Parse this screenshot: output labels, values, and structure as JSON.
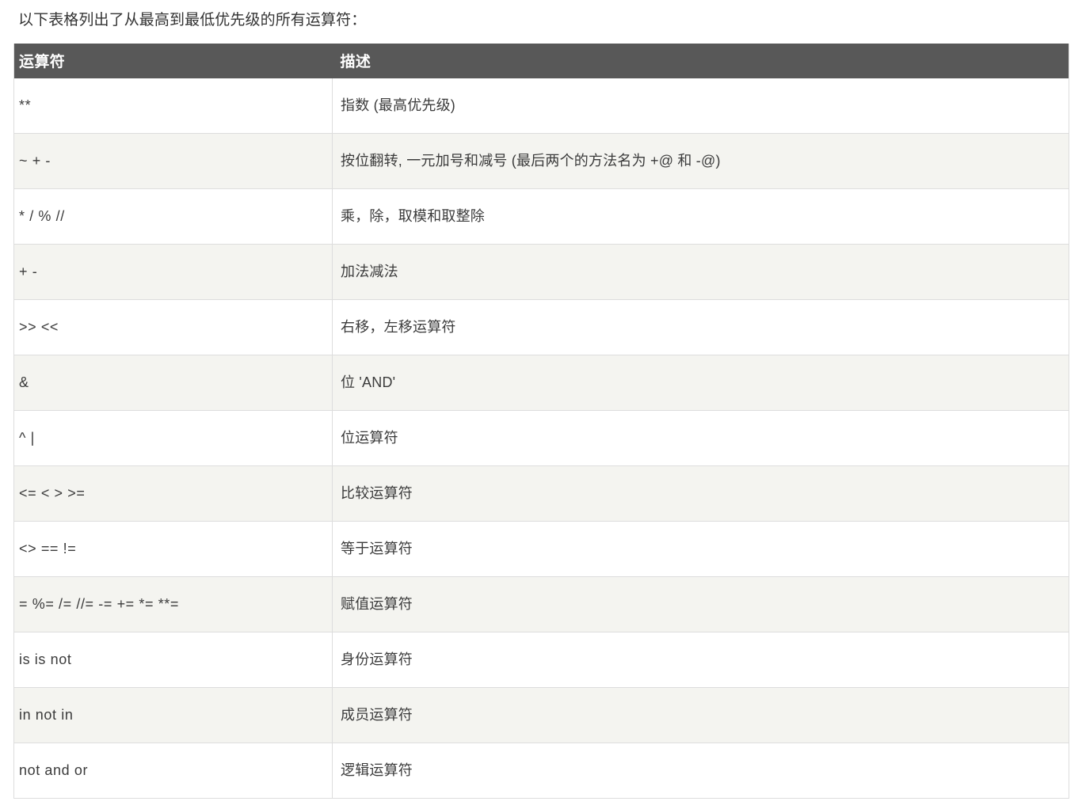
{
  "intro": "以下表格列出了从最高到最低优先级的所有运算符：",
  "table": {
    "columns": [
      {
        "key": "operator",
        "label": "运算符"
      },
      {
        "key": "description",
        "label": "描述"
      }
    ],
    "header_background": "#585858",
    "header_text_color": "#ffffff",
    "zebra_color": "#f4f4f0",
    "border_color": "#dddddd",
    "rows": [
      {
        "operator": "**",
        "description": "指数 (最高优先级)"
      },
      {
        "operator": "~ + -",
        "description": "按位翻转, 一元加号和减号 (最后两个的方法名为 +@ 和 -@)"
      },
      {
        "operator": "* / % //",
        "description": "乘，除，取模和取整除"
      },
      {
        "operator": "+ -",
        "description": "加法减法"
      },
      {
        "operator": ">> <<",
        "description": "右移，左移运算符"
      },
      {
        "operator": "&",
        "description": "位 'AND'"
      },
      {
        "operator": "^ |",
        "description": "位运算符"
      },
      {
        "operator": "<= < > >=",
        "description": "比较运算符"
      },
      {
        "operator": "<> == !=",
        "description": "等于运算符"
      },
      {
        "operator": "= %= /= //= -= += *= **=",
        "description": "赋值运算符"
      },
      {
        "operator": "is is not",
        "description": "身份运算符"
      },
      {
        "operator": "in not in",
        "description": "成员运算符"
      },
      {
        "operator": "not and or",
        "description": "逻辑运算符"
      }
    ]
  }
}
